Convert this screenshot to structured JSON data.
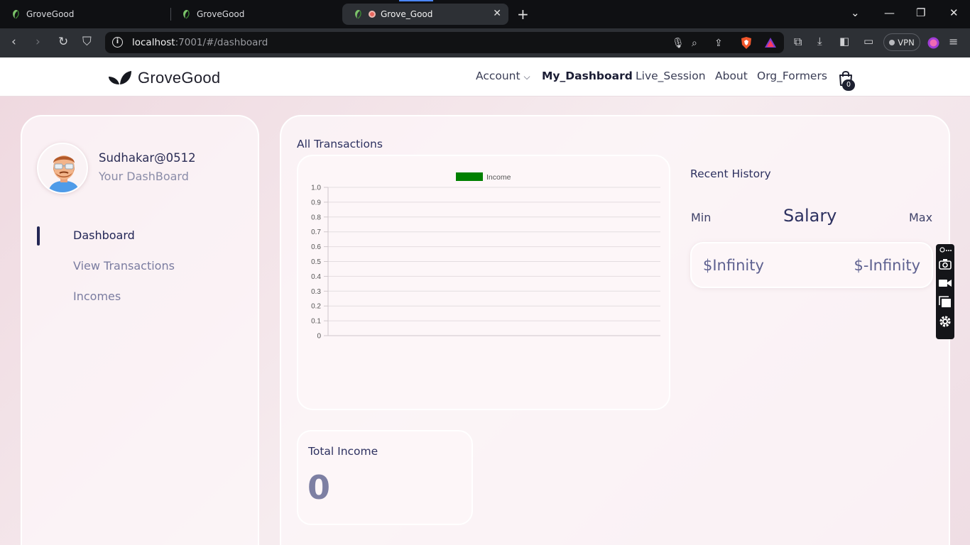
{
  "browser": {
    "tabs": [
      {
        "title": "GroveGood"
      },
      {
        "title": "GroveGood"
      },
      {
        "title": "Grove_Good"
      }
    ],
    "url_host": "localhost",
    "url_rest": ":7001/#/dashboard",
    "vpn_label": "VPN"
  },
  "header": {
    "brand": "GroveGood",
    "nav": [
      "Account",
      "My_Dashboard",
      "Live_Session",
      "About",
      "Org_Formers"
    ],
    "cart_count": "0"
  },
  "sidebar": {
    "username": "Sudhakar@0512",
    "subtitle": "Your DashBoard",
    "menu": [
      "Dashboard",
      "View Transactions",
      "Incomes"
    ]
  },
  "main": {
    "section_title": "All Transactions",
    "recent_history": "Recent History",
    "min_label": "Min",
    "salary_label": "Salary",
    "max_label": "Max",
    "min_value": "$Infinity",
    "max_value": "$-Infinity",
    "total_income_label": "Total Income",
    "total_income_value": "0"
  },
  "chart_data": {
    "type": "line",
    "title": "",
    "series": [
      {
        "name": "Income",
        "values": [],
        "color": "#008000"
      }
    ],
    "y_ticks": [
      "1.0",
      "0.9",
      "0.8",
      "0.7",
      "0.6",
      "0.5",
      "0.4",
      "0.3",
      "0.2",
      "0.1",
      "0"
    ],
    "ylim": [
      0,
      1
    ],
    "grid": true,
    "legend": "top"
  },
  "colors": {
    "accent": "#232654",
    "legend_income": "#008000"
  }
}
